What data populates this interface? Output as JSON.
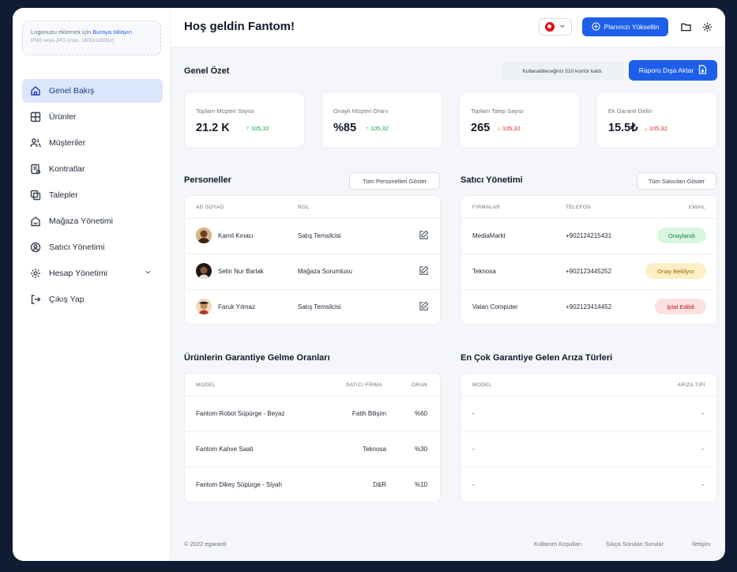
{
  "sidebar": {
    "logo_upload": {
      "text": "Logonuzu eklemek için",
      "link": "Buraya tıklayın",
      "hint": "PNG veya JPG (max. 1600x1200px)"
    },
    "items": [
      {
        "label": "Genel Bakış",
        "icon": "home-icon",
        "active": true
      },
      {
        "label": "Ürünler",
        "icon": "grid-icon"
      },
      {
        "label": "Müşteriler",
        "icon": "users-icon"
      },
      {
        "label": "Kontratlar",
        "icon": "contract-icon"
      },
      {
        "label": "Talepler",
        "icon": "copy-icon"
      },
      {
        "label": "Mağaza Yönetimi",
        "icon": "store-icon"
      },
      {
        "label": "Satıcı Yönetimi",
        "icon": "seller-icon"
      },
      {
        "label": "Hesap Yönetimi",
        "icon": "settings-icon"
      },
      {
        "label": "Çıkış Yap",
        "icon": "logout-icon"
      }
    ]
  },
  "header": {
    "welcome": "Hoş geldin Fantom!",
    "upgrade_label": "Planınızı Yükseltin"
  },
  "overview": {
    "title": "Genel Özet",
    "credits": "Kullanabileceğiniz 510 kontör kaldı.",
    "export_label": "Raporu Dışa Aktar",
    "stats": [
      {
        "label": "Toplam Müşteri Sayısı",
        "value": "21.2 K",
        "delta": "↑ 105,32",
        "trend": "up"
      },
      {
        "label": "Onaylı Müşteri Oranı",
        "value": "%85",
        "delta": "↑ 105,32",
        "trend": "up"
      },
      {
        "label": "Toplam Talep Sayısı",
        "value": "265",
        "delta": "↓ 105,32",
        "trend": "down"
      },
      {
        "label": "Ek Garanti Geliri",
        "value": "15.5₺",
        "delta": "↓ 105,32",
        "trend": "down"
      }
    ]
  },
  "personnel": {
    "title": "Personeller",
    "show_all": "Tüm Personelleri Göster",
    "columns": [
      "AD SOYAD",
      "ROL"
    ],
    "rows": [
      {
        "name": "Kamil Kınacı",
        "role": "Satış Temsilcisi"
      },
      {
        "name": "Selin Nur Barlak",
        "role": "Mağaza Sorumlusu"
      },
      {
        "name": "Faruk Yılmaz",
        "role": "Satış Temsilcisi"
      }
    ]
  },
  "sellers": {
    "title": "Satıcı Yönetimi",
    "show_all": "Tüm Satıcıları Göster",
    "columns": [
      "FIRMALAR",
      "TELEFON",
      "EMAIL"
    ],
    "rows": [
      {
        "firm": "MediaMarkt",
        "phone": "+902124215431",
        "status": "Onaylandı",
        "tone": "green"
      },
      {
        "firm": "Teknosa",
        "phone": "+902123445252",
        "status": "Onay Bekliyor",
        "tone": "yellow"
      },
      {
        "firm": "Vatan Computer",
        "phone": "+902123414452",
        "status": "İptal Edildi",
        "tone": "red"
      }
    ]
  },
  "warranty_rates": {
    "title": "Ürünlerin Garantiye Gelme Oranları",
    "columns": [
      "MODEL",
      "SATICI FİRMA",
      "ORAN"
    ],
    "rows": [
      {
        "model": "Fantom Robot Süpürge - Beyaz",
        "firm": "Fatih Bilişim",
        "rate": "%60"
      },
      {
        "model": "Fantom Kahve Saati",
        "firm": "Teknosa",
        "rate": "%30"
      },
      {
        "model": "Fantom Dikey Süpürge - Siyah",
        "firm": "D&R",
        "rate": "%10"
      }
    ]
  },
  "fault_types": {
    "title": "En Çok Garantiye Gelen Arıza Türleri",
    "columns": [
      "MODEL",
      "ARIZA TİPİ"
    ],
    "rows": [
      {
        "model": "-",
        "type": "-"
      },
      {
        "model": "-",
        "type": "-"
      },
      {
        "model": "-",
        "type": "-"
      }
    ]
  },
  "footer": {
    "copyright": "© 2022 egaranti",
    "links": [
      "Kullanım Koşulları",
      "Sıkça Sorulan Sorular",
      "İletişim"
    ]
  },
  "colors": {
    "primary": "#1d5fe8",
    "active_nav": "#dbe6fb",
    "success": "#16a34a",
    "danger": "#dc2626",
    "warning_bg": "#fdefc4"
  }
}
